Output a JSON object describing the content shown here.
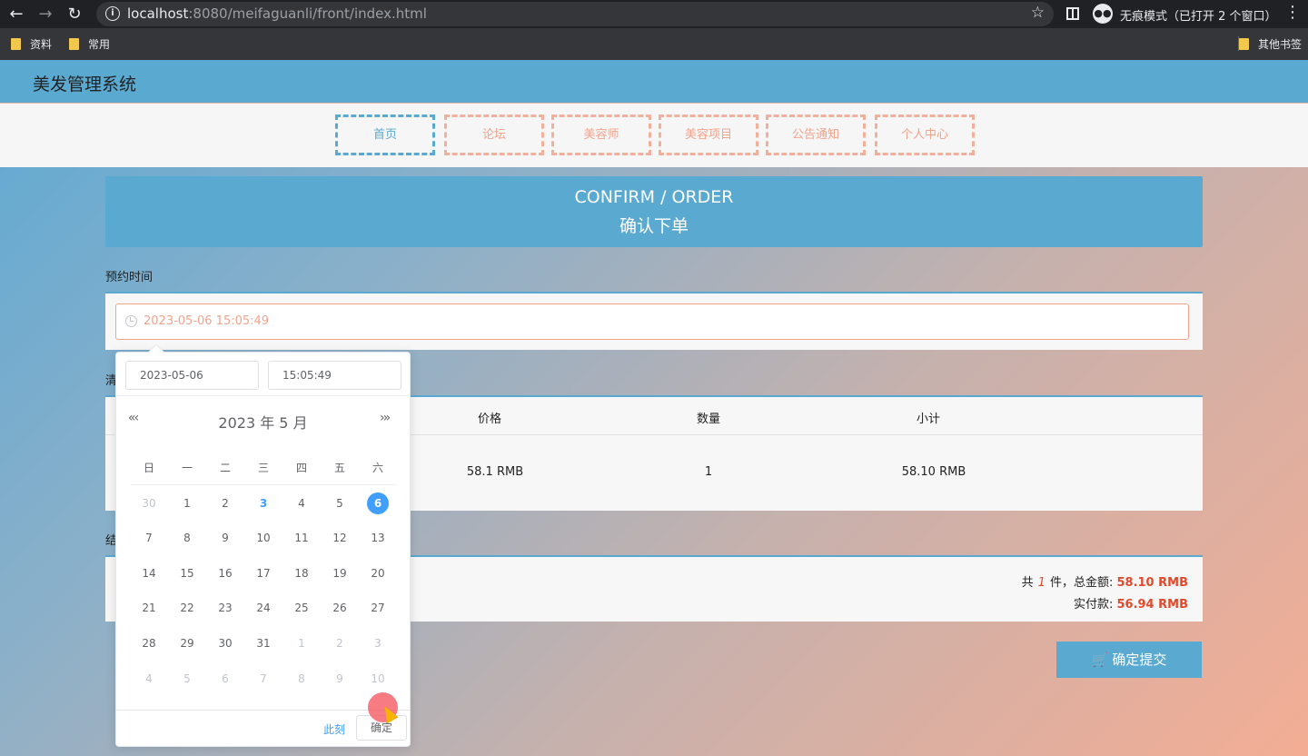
{
  "browser": {
    "url_host": "localhost",
    "url_rest": ":8080/meifaguanli/front/index.html",
    "incognito_label": "无痕模式（已打开 2 个窗口）",
    "bookmarks": [
      "资料",
      "常用"
    ],
    "other_bookmarks": "其他书签"
  },
  "site": {
    "title": "美发管理系统"
  },
  "nav": {
    "items": [
      {
        "label": "首页",
        "active": true
      },
      {
        "label": "论坛"
      },
      {
        "label": "美容师"
      },
      {
        "label": "美容项目"
      },
      {
        "label": "公告通知"
      },
      {
        "label": "个人中心"
      }
    ]
  },
  "banner": {
    "en": "CONFIRM / ORDER",
    "cn": "确认下单"
  },
  "appointment": {
    "label": "预约时间",
    "value": "2023-05-06 15:05:49"
  },
  "list": {
    "label_partial": "清",
    "headers": [
      "价格",
      "数量",
      "小计"
    ],
    "row": {
      "price": "58.1 RMB",
      "qty": "1",
      "subtotal": "58.10 RMB"
    }
  },
  "settlement": {
    "label_partial": "结",
    "count_prefix": "共",
    "count": "1",
    "count_suffix": "件，总金额:",
    "total": "58.10 RMB",
    "paid_label": "实付款:",
    "paid": "56.94 RMB"
  },
  "submit_label": "确定提交",
  "picker": {
    "date_input": "2023-05-06",
    "time_input": "15:05:49",
    "title": "2023 年  5 月",
    "prev": "«‹",
    "next": "›»",
    "weekdays": [
      "日",
      "一",
      "二",
      "三",
      "四",
      "五",
      "六"
    ],
    "weeks": [
      [
        "30",
        "1",
        "2",
        "3",
        "4",
        "5",
        "6"
      ],
      [
        "7",
        "8",
        "9",
        "10",
        "11",
        "12",
        "13"
      ],
      [
        "14",
        "15",
        "16",
        "17",
        "18",
        "19",
        "20"
      ],
      [
        "21",
        "22",
        "23",
        "24",
        "25",
        "26",
        "27"
      ],
      [
        "28",
        "29",
        "30",
        "31",
        "1",
        "2",
        "3"
      ],
      [
        "4",
        "5",
        "6",
        "7",
        "8",
        "9",
        "10"
      ]
    ],
    "today": "3",
    "selected": "6",
    "now_label": "此刻",
    "ok_label": "确定"
  }
}
